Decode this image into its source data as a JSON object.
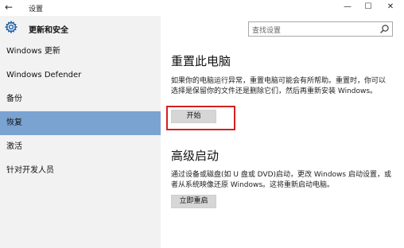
{
  "window": {
    "title": "设置",
    "back_glyph": "←",
    "minimize_glyph": "—",
    "maximize_glyph": "☐",
    "close_glyph": "✕"
  },
  "sidebar": {
    "header_title": "更新和安全",
    "header_icon": "gear-icon",
    "items": [
      {
        "label": "Windows 更新",
        "active": false
      },
      {
        "label": "Windows Defender",
        "active": false
      },
      {
        "label": "备份",
        "active": false
      },
      {
        "label": "恢复",
        "active": true
      },
      {
        "label": "激活",
        "active": false
      },
      {
        "label": "针对开发人员",
        "active": false
      }
    ],
    "active_color": "#7aa3d2"
  },
  "search": {
    "placeholder": "查找设置",
    "icon": "search-icon"
  },
  "reset": {
    "heading": "重置此电脑",
    "description": "如果你的电脑运行异常，重置电脑可能会有所帮助。重置时，你可以选择是保留你的文件还是删除它们，然后再重新安装 Windows。",
    "button_label": "开始",
    "highlight_color": "#d42020"
  },
  "advanced": {
    "heading": "高级启动",
    "description": "通过设备或磁盘(如 U 盘或 DVD)启动，更改 Windows 启动设置，或者从系统映像还原 Windows。这将重新启动电脑。",
    "button_label": "立即重启"
  }
}
